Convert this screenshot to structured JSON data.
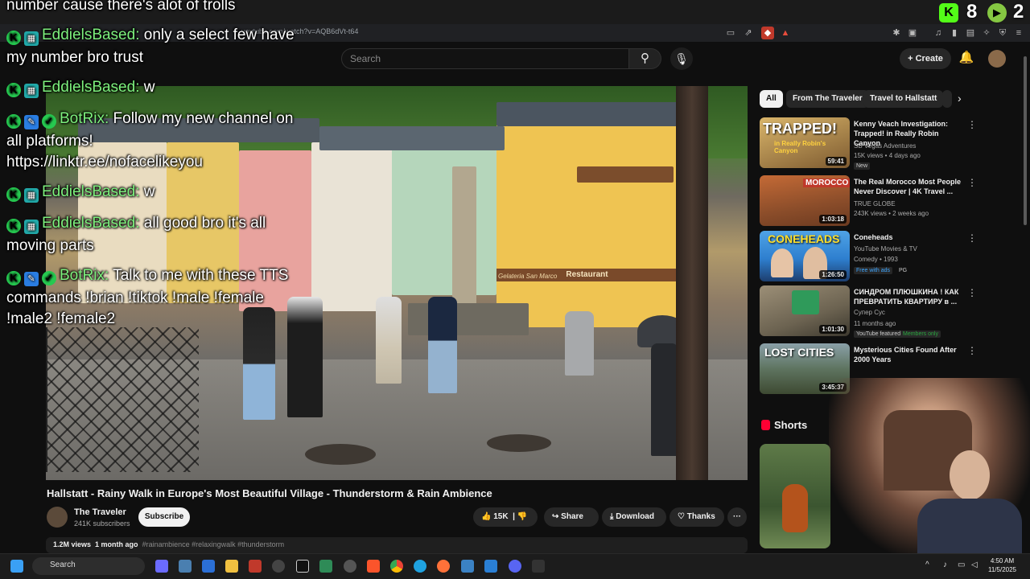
{
  "browser": {
    "url": "youtube.com/watch?v=AQB6dVt-t64"
  },
  "youtube_header": {
    "search_placeholder": "Search",
    "create_label": "Create"
  },
  "video": {
    "title": "Hallstatt - Rainy Walk in Europe's Most Beautiful Village - Thunderstorm & Rain Ambience",
    "channel": "The Traveler",
    "subscribers": "241K subscribers",
    "subscribe_label": "Subscribe",
    "likes": "15K",
    "share_label": "Share",
    "download_label": "Download",
    "thanks_label": "Thanks",
    "views": "1.2M views",
    "age": "1 month ago",
    "hashtags": "#rainambience #relaxingwalk #thunderstorm",
    "scene_text": {
      "restaurant": "Restaurant",
      "gelateria": "Gelateria San Marco"
    }
  },
  "chat_overlay": {
    "top_fragment": "number cause there's alot of trolls",
    "lines": [
      {
        "name": "EddielsBased:",
        "text": "only a select few have",
        "cont": "my number bro trust"
      },
      {
        "name": "EddielsBased:",
        "text": "w"
      },
      {
        "name": "BotRix:",
        "text": "Follow my new channel on",
        "cont": "all platforms!",
        "cont2": "https://linktr.ee/nofacelikeyou"
      },
      {
        "name": "EddielsBased:",
        "text": "w"
      },
      {
        "name": "EddielsBased:",
        "text": "all good bro it's all",
        "cont": "moving parts"
      },
      {
        "name": "BotRix:",
        "text": "Talk to me with these TTS",
        "cont": "commands !brian !tiktok !male !female",
        "cont2": "!male2 !female2"
      }
    ],
    "kick_viewers": "8",
    "rumble_viewers": "2"
  },
  "filter_chips": [
    "All",
    "From The Traveler",
    "Travel to Hallstatt"
  ],
  "recommendations": [
    {
      "title": "Kenny Veach Investigation: Trapped! in Really Robin Canyon",
      "channel": "SB Vegas Adventures",
      "meta": "15K views • 4 days ago",
      "tag": "New",
      "duration": "59:41",
      "thumb_text": "TRAPPED!",
      "thumb_sub": "in Really Robin's Canyon"
    },
    {
      "title": "The Real Morocco Most People Never Discover | 4K Travel ...",
      "channel": "TRUE GLOBE",
      "meta": "243K views • 2 weeks ago",
      "duration": "1:03:18",
      "thumb_text": "MOROCCO"
    },
    {
      "title": "Coneheads",
      "channel": "YouTube Movies & TV",
      "meta": "Comedy • 1993",
      "tag": "Free with ads",
      "tag2": "PG",
      "duration": "1:26:50",
      "thumb_text": "CONEHEADS"
    },
    {
      "title": "СИНДРОМ ПЛЮШКИНА ! КАК ПРЕВРАТИТЬ КВАРТИРУ в ...",
      "channel": "Супер Сус",
      "meta": "11 months ago",
      "tag": "YouTube featured",
      "tag2": "Members only",
      "duration": "1:01:30"
    },
    {
      "title": "Mysterious Cities Found After 2000 Years",
      "channel": "",
      "meta": "",
      "duration": "3:45:37",
      "thumb_text": "LOST CITIES"
    }
  ],
  "shorts_label": "Shorts",
  "taskbar": {
    "search_label": "Search",
    "time": "4:50 AM",
    "date": "11/5/2025"
  },
  "colors": {
    "accent_red": "#ff0033",
    "kick_green": "#53fc18",
    "chat_name_green": "#7df07d"
  }
}
